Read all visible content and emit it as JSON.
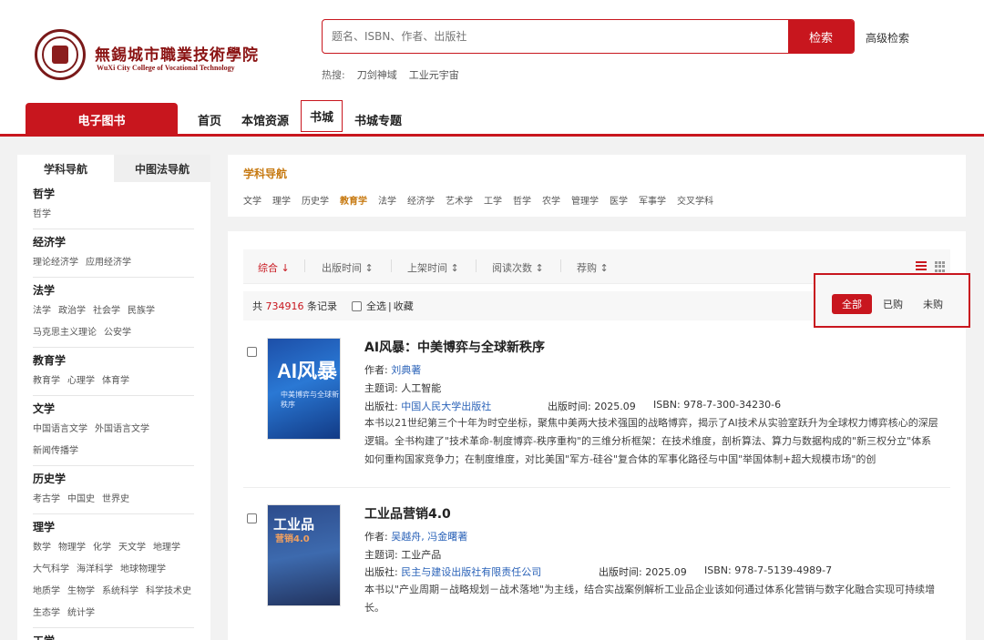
{
  "header": {
    "school_name": "無錫城市職業技術學院",
    "school_en": "WuXi City College of Vocational Technology",
    "search_placeholder": "题名、ISBN、作者、出版社",
    "search_button": "检索",
    "advanced_search": "高级检索",
    "hot_label": "热搜:",
    "hot_keywords": [
      "刀剑神域",
      "工业元宇宙"
    ]
  },
  "nav": {
    "main_tab": "电子图书",
    "items": [
      "首页",
      "本馆资源",
      "书城",
      "书城专题"
    ]
  },
  "sidebar": {
    "tabs": [
      "学科导航",
      "中图法导航"
    ],
    "categories": [
      {
        "name": "哲学",
        "subs": [
          "哲学"
        ]
      },
      {
        "name": "经济学",
        "subs": [
          "理论经济学",
          "应用经济学"
        ]
      },
      {
        "name": "法学",
        "subs": [
          "法学",
          "政治学",
          "社会学",
          "民族学",
          "马克思主义理论",
          "公安学"
        ]
      },
      {
        "name": "教育学",
        "subs": [
          "教育学",
          "心理学",
          "体育学"
        ]
      },
      {
        "name": "文学",
        "subs": [
          "中国语言文学",
          "外国语言文学",
          "新闻传播学"
        ]
      },
      {
        "name": "历史学",
        "subs": [
          "考古学",
          "中国史",
          "世界史"
        ]
      },
      {
        "name": "理学",
        "subs": [
          "数学",
          "物理学",
          "化学",
          "天文学",
          "地理学",
          "大气科学",
          "海洋科学",
          "地球物理学",
          "地质学",
          "生物学",
          "系统科学",
          "科学技术史",
          "生态学",
          "统计学"
        ]
      },
      {
        "name": "工学",
        "subs": []
      }
    ]
  },
  "subject_panel": {
    "title": "学科导航",
    "subjects": [
      "文学",
      "理学",
      "历史学",
      "教育学",
      "法学",
      "经济学",
      "艺术学",
      "工学",
      "哲学",
      "农学",
      "管理学",
      "医学",
      "军事学",
      "交叉学科"
    ],
    "active": "教育学"
  },
  "sortbar": {
    "items": [
      "综合",
      "出版时间",
      "上架时间",
      "阅读次数",
      "荐购"
    ],
    "arrow_active": "↓",
    "arrow": "↕"
  },
  "records": {
    "prefix": "共",
    "count": "734916",
    "suffix": "条记录",
    "select_all": "全选",
    "separator": "|",
    "favorite": "收藏"
  },
  "filter": {
    "options": [
      "全部",
      "已购",
      "未购"
    ]
  },
  "books": [
    {
      "title": "AI风暴：中美博弈与全球新秩序",
      "cover_title": "AI风暴",
      "cover_sub": "中美博弈与全球新秩序",
      "author_label": "作者:",
      "author": "刘典著",
      "keyword_label": "主题词:",
      "keyword": "人工智能",
      "publisher_label": "出版社:",
      "publisher": "中国人民大学出版社",
      "date_label": "出版时间:",
      "date": "2025.09",
      "isbn_label": "ISBN:",
      "isbn": "978-7-300-34230-6",
      "desc": "本书以21世纪第三个十年为时空坐标，聚焦中美两大技术强国的战略博弈，揭示了AI技术从实验室跃升为全球权力博弈核心的深层逻辑。全书构建了\"技术革命-制度博弈-秩序重构\"的三维分析框架：在技术维度，剖析算法、算力与数据构成的\"新三权分立\"体系如何重构国家竞争力；在制度维度，对比美国\"军方-硅谷\"复合体的军事化路径与中国\"举国体制+超大规模市场\"的创"
    },
    {
      "title": "工业品营销4.0",
      "cover_title": "工业品",
      "cover_sub": "营销4.0",
      "author_label": "作者:",
      "author": "吴越舟, 冯金曙著",
      "keyword_label": "主题词:",
      "keyword": "工业产品",
      "publisher_label": "出版社:",
      "publisher": "民主与建设出版社有限责任公司",
      "date_label": "出版时间:",
      "date": "2025.09",
      "isbn_label": "ISBN:",
      "isbn": "978-7-5139-4989-7",
      "desc": "本书以\"产业周期－战略规划－战术落地\"为主线，结合实战案例解析工业品企业该如何通过体系化营销与数字化融合实现可持续增长。"
    }
  ],
  "colors": {
    "brand_red": "#c8161e",
    "accent_orange": "#c77a12",
    "link_blue": "#2a62b8"
  }
}
